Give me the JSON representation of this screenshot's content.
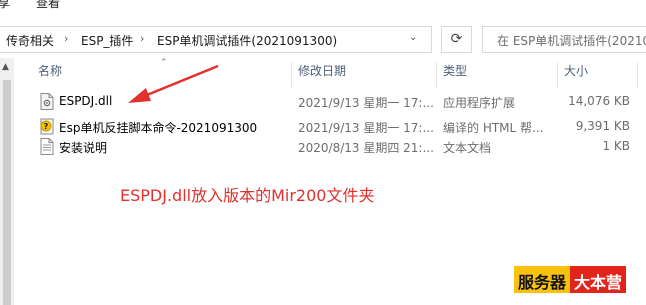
{
  "menu": {
    "items": [
      "享",
      "查看"
    ]
  },
  "breadcrumb": {
    "items": [
      "传奇相关",
      "ESP_插件",
      "ESP单机调试插件(2021091300)"
    ],
    "separator": "›"
  },
  "search": {
    "placeholder": "在 ESP单机调试插件(20210913"
  },
  "columns": {
    "name": "名称",
    "date": "修改日期",
    "type": "类型",
    "size": "大小"
  },
  "files": [
    {
      "name": "ESPDJ.dll",
      "date": "2021/9/13 星期一 17:...",
      "type": "应用程序扩展",
      "size": "14,076 KB",
      "icon": "dll-file-icon"
    },
    {
      "name": "Esp单机反挂脚本命令-2021091300",
      "date": "2021/9/13 星期一 17:...",
      "type": "编译的 HTML 帮...",
      "size": "9,391 KB",
      "icon": "chm-help-file-icon"
    },
    {
      "name": "安装说明",
      "date": "2020/8/13 星期四 21:...",
      "type": "文本文档",
      "size": "1 KB",
      "icon": "text-file-icon"
    }
  ],
  "annotation": {
    "text": "ESPDJ.dll放入版本的Mir200文件夹",
    "color": "#e2312c"
  },
  "watermark": {
    "left": "服务器",
    "right": "大本营"
  }
}
